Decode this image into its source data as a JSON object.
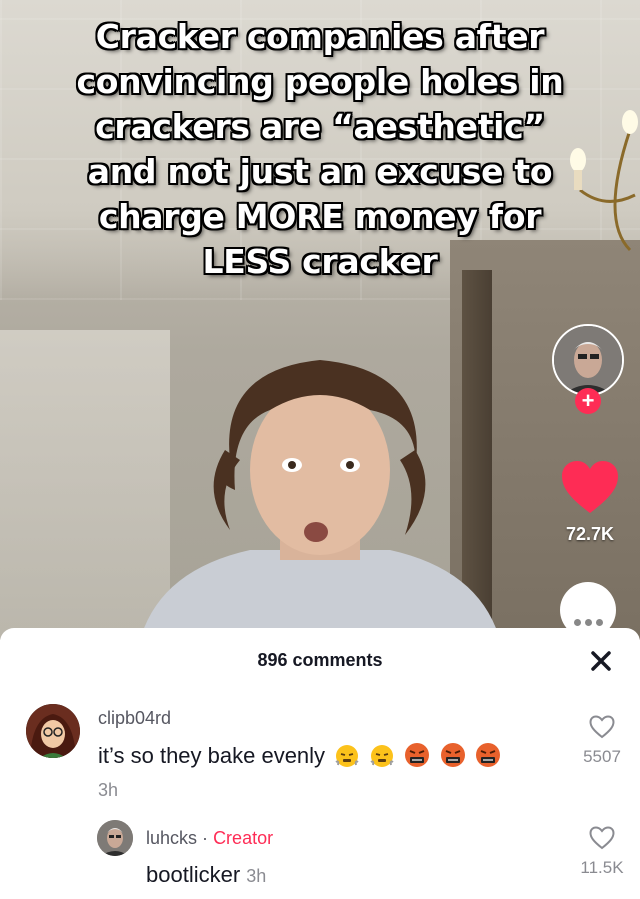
{
  "video": {
    "caption": "Cracker companies after\nconvincing people holes in\ncrackers are “aesthetic”\nand not just an excuse to\ncharge MORE money for\nLESS cracker",
    "like_count": "72.7K",
    "follow_symbol": "+"
  },
  "comments_sheet": {
    "title": "896 comments",
    "close_symbol": "✕",
    "comments": [
      {
        "username": "clipb04rd",
        "text": "it’s so they bake evenly",
        "emojis": [
          "face-with-steam-icon",
          "face-with-steam-icon",
          "face-with-symbols-icon",
          "face-with-symbols-icon",
          "face-with-symbols-icon"
        ],
        "time": "3h",
        "likes": "5507"
      },
      {
        "username": "luhcks",
        "separator": "·",
        "badge": "Creator",
        "text": "bootlicker",
        "time": "3h",
        "likes": "11.5K"
      }
    ]
  },
  "colors": {
    "accent": "#fe2c55",
    "text": "#161823",
    "muted": "#8a8b91"
  }
}
